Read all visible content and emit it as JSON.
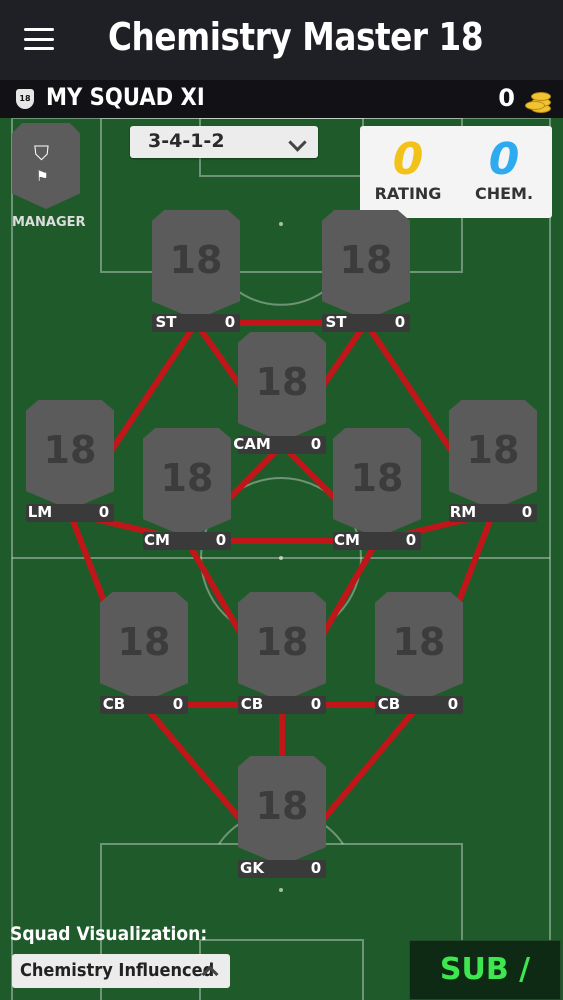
{
  "header": {
    "title": "Chemistry Master 18"
  },
  "squad_bar": {
    "badge": "18",
    "title": "MY SQUAD XI",
    "coins": "0"
  },
  "manager": {
    "label": "MANAGER"
  },
  "formation": {
    "value": "3-4-1-2"
  },
  "stats": {
    "rating": {
      "value": "0",
      "label": "RATING",
      "color": "#f2c21a"
    },
    "chemistry": {
      "value": "0",
      "label": "CHEM.",
      "color": "#2eaaf0"
    }
  },
  "players": [
    {
      "id": "st1",
      "position": "ST",
      "rating": "18",
      "chem": "0"
    },
    {
      "id": "st2",
      "position": "ST",
      "rating": "18",
      "chem": "0"
    },
    {
      "id": "cam",
      "position": "CAM",
      "rating": "18",
      "chem": "0"
    },
    {
      "id": "lm",
      "position": "LM",
      "rating": "18",
      "chem": "0"
    },
    {
      "id": "cm1",
      "position": "CM",
      "rating": "18",
      "chem": "0"
    },
    {
      "id": "cm2",
      "position": "CM",
      "rating": "18",
      "chem": "0"
    },
    {
      "id": "rm",
      "position": "RM",
      "rating": "18",
      "chem": "0"
    },
    {
      "id": "cb1",
      "position": "CB",
      "rating": "18",
      "chem": "0"
    },
    {
      "id": "cb2",
      "position": "CB",
      "rating": "18",
      "chem": "0"
    },
    {
      "id": "cb3",
      "position": "CB",
      "rating": "18",
      "chem": "0"
    },
    {
      "id": "gk",
      "position": "GK",
      "rating": "18",
      "chem": "0"
    }
  ],
  "links": [
    [
      "st1",
      "st2"
    ],
    [
      "st1",
      "cam"
    ],
    [
      "st2",
      "cam"
    ],
    [
      "st1",
      "lm"
    ],
    [
      "st2",
      "rm"
    ],
    [
      "cam",
      "cm1"
    ],
    [
      "cam",
      "cm2"
    ],
    [
      "lm",
      "cm1"
    ],
    [
      "cm1",
      "cm2"
    ],
    [
      "cm2",
      "rm"
    ],
    [
      "lm",
      "cb1"
    ],
    [
      "cm1",
      "cb2"
    ],
    [
      "cm2",
      "cb2"
    ],
    [
      "rm",
      "cb3"
    ],
    [
      "cb1",
      "cb2"
    ],
    [
      "cb2",
      "cb3"
    ],
    [
      "cb1",
      "gk"
    ],
    [
      "cb2",
      "gk"
    ],
    [
      "cb3",
      "gk"
    ]
  ],
  "link_color": "#c0161a",
  "colors": {
    "pitch": "#1f5b2a",
    "card": "#5b5b5b",
    "sub_res": "#3ee64f"
  },
  "visualization": {
    "label": "Squad Visualization:",
    "value": "Chemistry Influenced"
  },
  "sub_res_label": "SUB / RES"
}
